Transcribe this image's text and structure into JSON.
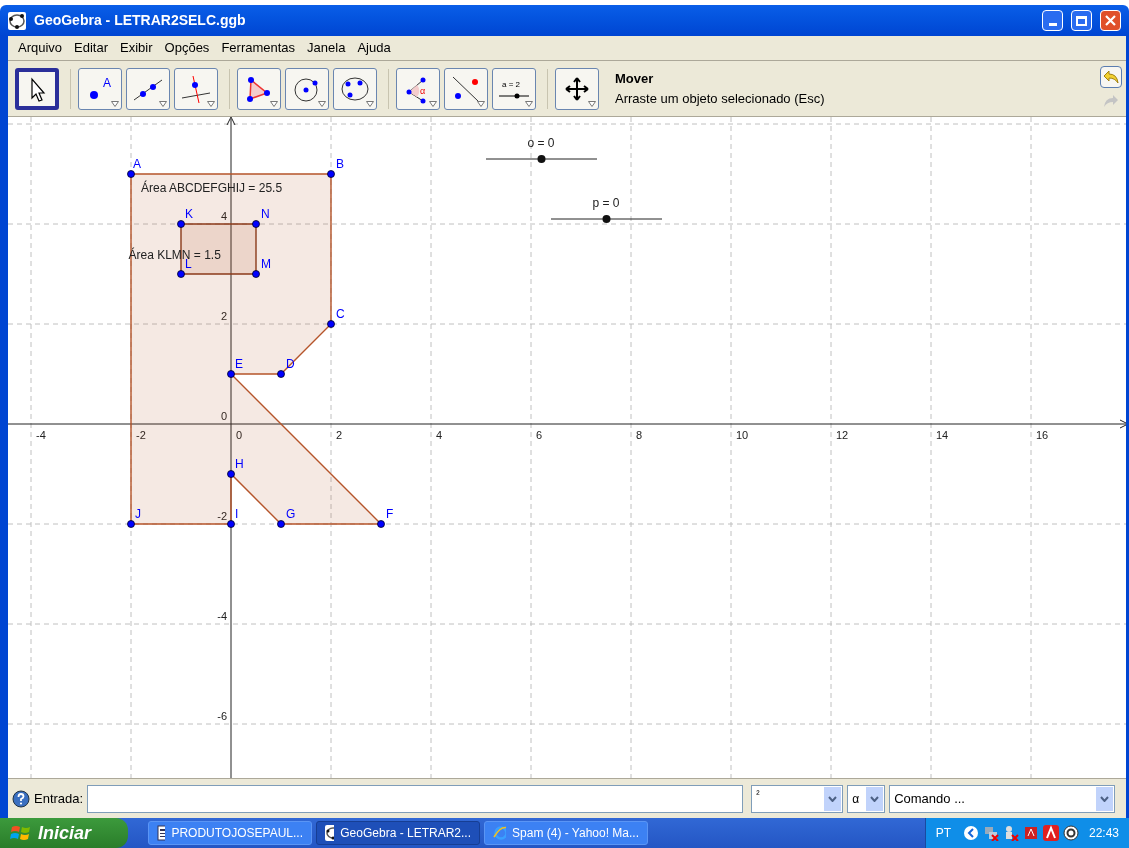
{
  "window": {
    "title": "GeoGebra - LETRAR2SELC.ggb"
  },
  "menu": [
    "Arquivo",
    "Editar",
    "Exibir",
    "Opções",
    "Ferramentas",
    "Janela",
    "Ajuda"
  ],
  "toolbar": {
    "tools": [
      {
        "kind": "move",
        "selected": true
      },
      {
        "kind": "point",
        "selected": false,
        "text": "A"
      },
      {
        "kind": "line",
        "selected": false
      },
      {
        "kind": "perpendicular",
        "selected": false
      },
      {
        "kind": "polygon",
        "selected": false
      },
      {
        "kind": "circle",
        "selected": false
      },
      {
        "kind": "conic",
        "selected": false
      },
      {
        "kind": "angle",
        "selected": false,
        "text": "α"
      },
      {
        "kind": "reflect",
        "selected": false
      },
      {
        "kind": "slider",
        "selected": false,
        "text": "a = 2"
      },
      {
        "kind": "pan",
        "selected": false
      }
    ],
    "tool_name": "Mover",
    "tool_hint": "Arraste um objeto selecionado (Esc)"
  },
  "graphics": {
    "x_ticks": [
      "-4",
      "-2",
      "0",
      "2",
      "4",
      "6",
      "8",
      "10",
      "12",
      "14",
      "16"
    ],
    "y_ticks": [
      "4",
      "2",
      "0",
      "-2",
      "-4",
      "-6"
    ],
    "points": [
      {
        "label": "A"
      },
      {
        "label": "B"
      },
      {
        "label": "K"
      },
      {
        "label": "N"
      },
      {
        "label": "L"
      },
      {
        "label": "M"
      },
      {
        "label": "C"
      },
      {
        "label": "E"
      },
      {
        "label": "D"
      },
      {
        "label": "H"
      },
      {
        "label": "J"
      },
      {
        "label": "I"
      },
      {
        "label": "G"
      },
      {
        "label": "F"
      }
    ],
    "area_labels": [
      "Área ABCDEFGHIJ = 25.5",
      "Área KLMN = 1.5"
    ],
    "sliders": [
      {
        "label": "o = 0",
        "level": 0.5
      },
      {
        "label": "p = 0",
        "level": 0.5
      }
    ]
  },
  "input_bar": {
    "label": "Entrada:",
    "symbols": "²",
    "greek": "α",
    "command": "Comando ..."
  },
  "taskbar": {
    "start": "Iniciar",
    "tasks": [
      {
        "kind": "document",
        "label": "PRODUTOJOSEPAUL...",
        "selected": false
      },
      {
        "kind": "geogebra",
        "label": "GeoGebra - LETRAR2...",
        "selected": true
      },
      {
        "kind": "browser",
        "label": "Spam (4) - Yahoo! Ma...",
        "selected": false
      }
    ],
    "language": "PT",
    "clock": "22:43"
  }
}
